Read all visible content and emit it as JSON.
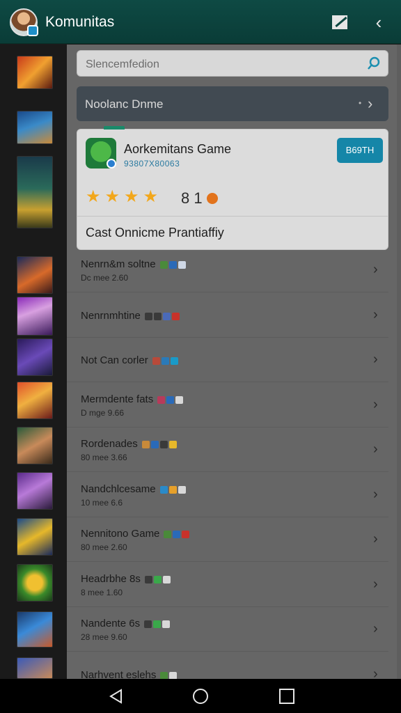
{
  "appbar": {
    "title": "Komunitas"
  },
  "search": {
    "placeholder": "Slencemfedion"
  },
  "banner": {
    "label": "Noolanc Dnme"
  },
  "featured": {
    "name": "Aorkemitans Game",
    "subtitle": "93807X80063",
    "install_label": "B69TH",
    "stars": 4,
    "rating_text": "8 1",
    "footer": "Cast Onnicme Prantiaffiy"
  },
  "list": [
    {
      "name": "Nenrn&m soltne",
      "meta": "Dc mee  2.60",
      "tag_colors": [
        "#4a8a3a",
        "#2a6ab8",
        "#cfd8e6"
      ]
    },
    {
      "name": "Nenrnmhtine",
      "meta": "",
      "tag_colors": [
        "#3a3a3a",
        "#3a3a3a",
        "#4a6ab8",
        "#c8322a"
      ]
    },
    {
      "name": "Not Can corler",
      "meta": "",
      "tag_colors": [
        "#b84a3a",
        "#2a7ab8",
        "#1a9ac8"
      ]
    },
    {
      "name": "Mermdente fats",
      "meta": "D mge  9.66",
      "tag_colors": [
        "#b83a5a",
        "#2a6ab8",
        "#d8d8d8"
      ]
    },
    {
      "name": "Rordenades",
      "meta": "80 mee  3.66",
      "tag_colors": [
        "#c88a3a",
        "#2a6ab8",
        "#3a3a3a",
        "#e6b82a"
      ]
    },
    {
      "name": "Nandchlcesame",
      "meta": "10 mee  6.6",
      "tag_colors": [
        "#2a8ac8",
        "#e6a02a",
        "#d8d8d8"
      ]
    },
    {
      "name": "Nennitono Game",
      "meta": "80 mee  2.60",
      "tag_colors": [
        "#4a8a3a",
        "#2a6ab8",
        "#c8322a"
      ]
    },
    {
      "name": "Headrbhe 8s",
      "meta": "8 mee  1.60",
      "tag_colors": [
        "#3a3a3a",
        "#3aa84a",
        "#d8d8d8"
      ]
    },
    {
      "name": "Nandente 6s",
      "meta": "28 mee  9.60",
      "tag_colors": [
        "#3a3a3a",
        "#3aa84a",
        "#d8d8d8"
      ]
    },
    {
      "name": "Narhvent eslehs",
      "meta": "",
      "tag_colors": [
        "#4a8a3a",
        "#d8d8d8"
      ]
    }
  ],
  "icons": {
    "avatar": "avatar",
    "edit": "edit-icon",
    "back": "chevron-left-icon",
    "search": "search-icon",
    "chevron": "chevron-right-icon",
    "nav": [
      "back-triangle-icon",
      "home-circle-icon",
      "recents-square-icon"
    ]
  }
}
